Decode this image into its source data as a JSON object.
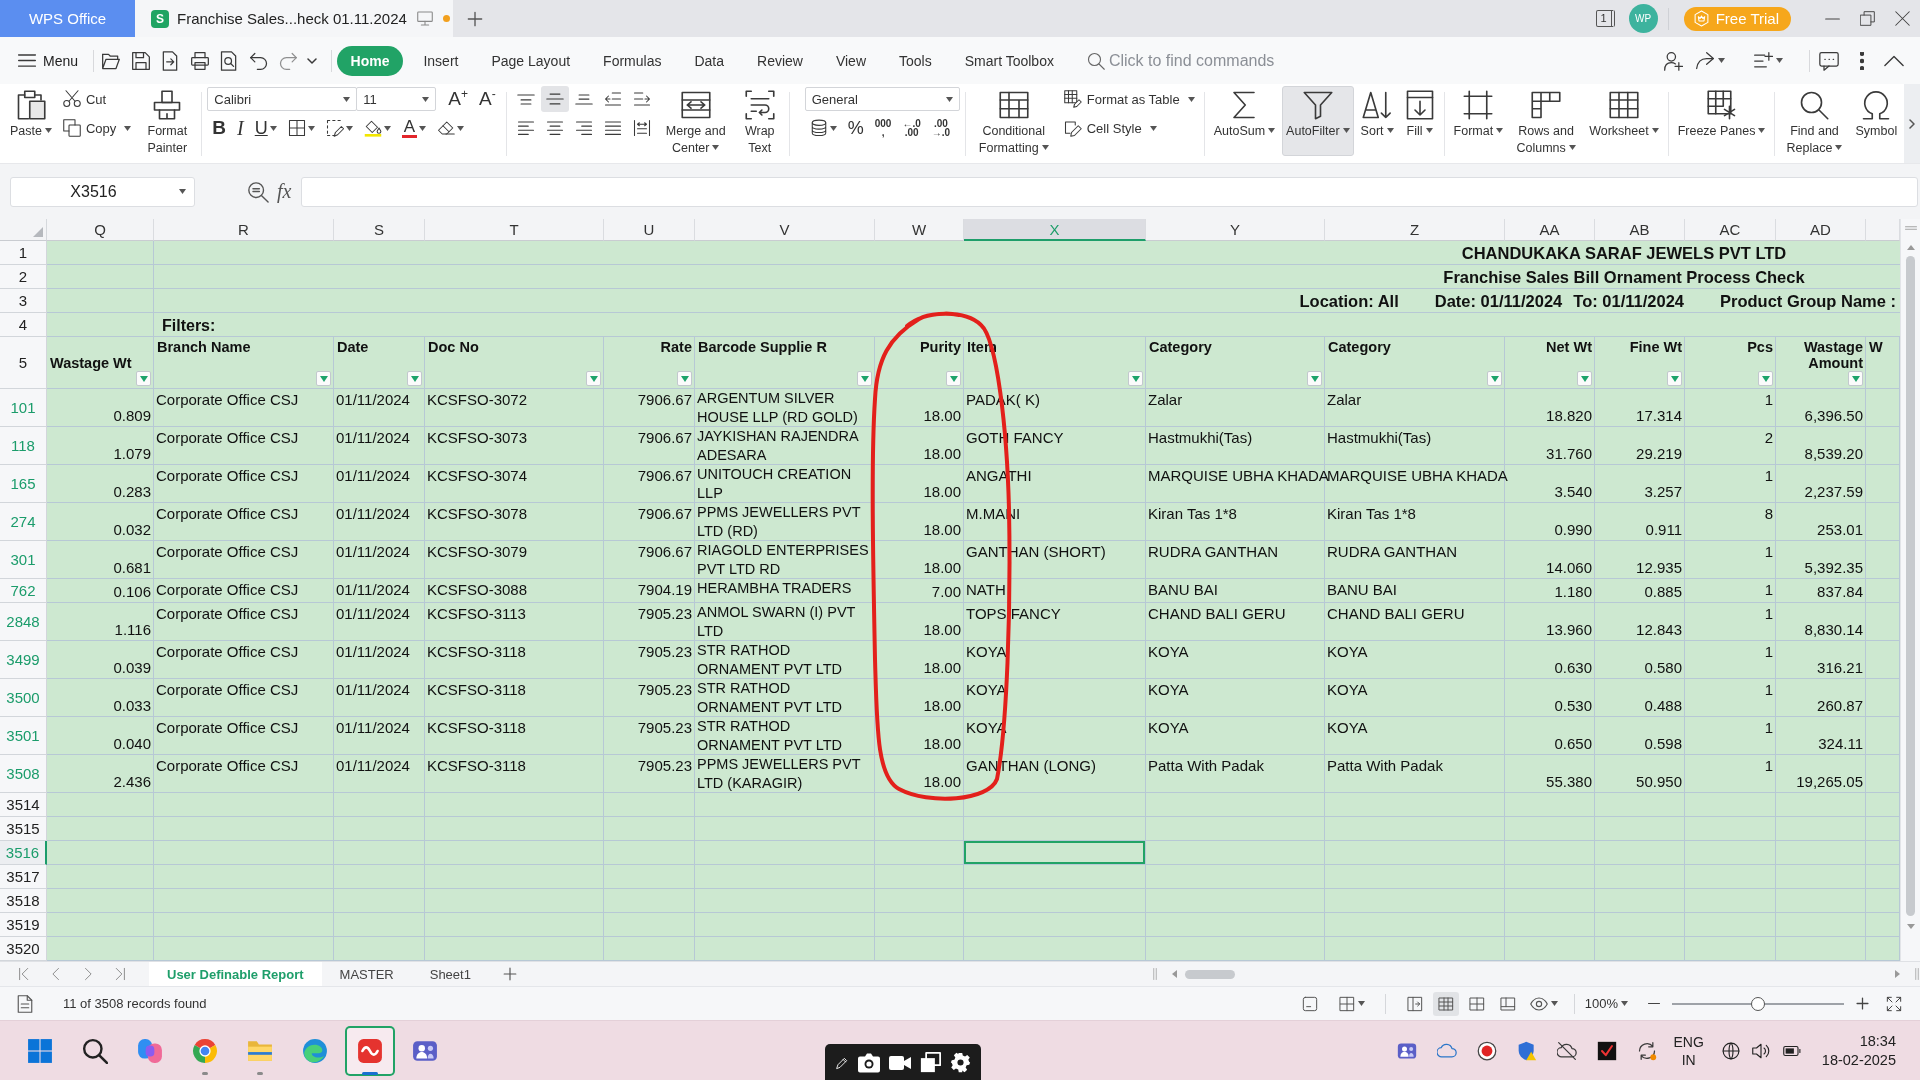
{
  "title_bar": {
    "tabs": [
      {
        "kind": "app",
        "label": "WPS Office",
        "selected": false
      },
      {
        "kind": "document",
        "label": "Franchise Sales...heck 01.11.2024",
        "logo": "S",
        "selected": true,
        "modified": true
      }
    ],
    "window_count": "1",
    "avatar": "WP",
    "trial_button": "Free Trial"
  },
  "menu_bar": {
    "menu_label": "Menu",
    "tabs": [
      {
        "label": "Home",
        "selected": true
      },
      {
        "label": "Insert",
        "selected": false
      },
      {
        "label": "Page Layout",
        "selected": false
      },
      {
        "label": "Formulas",
        "selected": false
      },
      {
        "label": "Data",
        "selected": false
      },
      {
        "label": "Review",
        "selected": false
      },
      {
        "label": "View",
        "selected": false
      },
      {
        "label": "Tools",
        "selected": false
      },
      {
        "label": "Smart Toolbox",
        "selected": false
      }
    ],
    "search": {
      "placeholder": "Click to find commands"
    }
  },
  "ribbon": {
    "groups": [
      {
        "items": [
          {
            "kind": "large",
            "label": "Paste",
            "dropdown": true,
            "selected": false
          },
          {
            "kind": "stack",
            "upper": [
              {
                "kind": "small",
                "label": "Cut",
                "dropdown": false,
                "selected": false
              }
            ],
            "lower": [
              {
                "kind": "small",
                "label": "Copy",
                "dropdown": true,
                "selected": false
              }
            ]
          },
          {
            "kind": "large",
            "label": "Format Painter",
            "dropdown": false,
            "selected": false
          }
        ]
      },
      {
        "items": [
          {
            "kind": "stack",
            "upper": [
              {
                "kind": "field",
                "value": "Calibri"
              },
              {
                "kind": "field",
                "value": "11"
              },
              {
                "kind": "glyph",
                "label": "A$^{+}$",
                "dropdown": false,
                "selected": false
              },
              {
                "kind": "glyph",
                "label": "A$^{-}$",
                "dropdown": false,
                "selected": false
              }
            ],
            "lower": [
              {
                "kind": "glyph",
                "label": "B",
                "dropdown": false,
                "selected": false
              },
              {
                "kind": "glyph",
                "label": "I",
                "dropdown": false,
                "selected": false
              },
              {
                "kind": "glyph",
                "label": "U",
                "dropdown": true,
                "selected": false
              },
              {
                "kind": "tool",
                "dropdown": true,
                "selected": false
              },
              {
                "kind": "tool",
                "dropdown": true,
                "selected": false
              },
              {
                "kind": "tool",
                "dropdown": true,
                "selected": false
              },
              {
                "kind": "glyph",
                "label": "A",
                "dropdown": true,
                "selected": false
              },
              {
                "kind": "tool",
                "dropdown": true,
                "selected": false
              }
            ]
          }
        ]
      },
      {
        "items": [
          {
            "kind": "stack",
            "upper": [
              {
                "kind": "tool",
                "dropdown": false,
                "selected": false
              },
              {
                "kind": "tool",
                "dropdown": false,
                "selected": true
              },
              {
                "kind": "tool",
                "dropdown": false,
                "selected": false
              },
              {
                "kind": "tool",
                "dropdown": false,
                "selected": false
              },
              {
                "kind": "tool",
                "dropdown": false,
                "selected": false
              }
            ],
            "lower": [
              {
                "kind": "tool",
                "dropdown": false,
                "selected": false
              },
              {
                "kind": "tool",
                "dropdown": false,
                "selected": false
              },
              {
                "kind": "tool",
                "dropdown": false,
                "selected": false
              },
              {
                "kind": "tool",
                "dropdown": false,
                "selected": false
              },
              {
                "kind": "tool",
                "dropdown": false,
                "selected": false
              }
            ]
          },
          {
            "kind": "large",
            "label": "Merge and Center",
            "dropdown": true,
            "selected": false
          },
          {
            "kind": "large",
            "label": "Wrap Text",
            "dropdown": false,
            "selected": false
          }
        ]
      },
      {
        "items": [
          {
            "kind": "stack",
            "upper": [
              {
                "kind": "field",
                "value": "General"
              }
            ],
            "lower": [
              {
                "kind": "tool",
                "dropdown": true,
                "selected": false
              },
              {
                "kind": "glyph",
                "label": "%",
                "dropdown": false,
                "selected": false
              },
              {
                "kind": "glyph",
                "lines": [
                  "000",
                  ","
                ],
                "dropdown": false,
                "selected": false
              },
              {
                "kind": "glyph",
                "lines": [
                  "←.0",
                  ".00"
                ],
                "dropdown": false,
                "selected": false
              },
              {
                "kind": "glyph",
                "lines": [
                  ".00",
                  "→.0"
                ],
                "dropdown": false,
                "selected": false
              }
            ]
          }
        ]
      },
      {
        "items": [
          {
            "kind": "large",
            "label": "Conditional Formatting",
            "dropdown": true,
            "selected": false
          },
          {
            "kind": "stack",
            "upper": [
              {
                "kind": "small",
                "label": "Format as Table",
                "dropdown": true,
                "selected": false
              }
            ],
            "lower": [
              {
                "kind": "small",
                "label": "Cell Style",
                "dropdown": true,
                "selected": false
              }
            ]
          }
        ]
      },
      {
        "items": [
          {
            "kind": "large",
            "label": "AutoSum",
            "dropdown": true,
            "selected": false
          },
          {
            "kind": "large",
            "label": "AutoFilter",
            "dropdown": true,
            "selected": true
          },
          {
            "kind": "large",
            "label": "Sort",
            "dropdown": true,
            "selected": false
          },
          {
            "kind": "large",
            "label": "Fill",
            "dropdown": true,
            "selected": false
          }
        ]
      },
      {
        "items": [
          {
            "kind": "large",
            "label": "Format",
            "dropdown": true,
            "selected": false
          },
          {
            "kind": "large",
            "label": "Rows and Columns",
            "dropdown": true,
            "selected": false
          },
          {
            "kind": "large",
            "label": "Worksheet",
            "dropdown": true,
            "selected": false
          }
        ]
      },
      {
        "items": [
          {
            "kind": "large",
            "label": "Freeze Panes",
            "dropdown": true,
            "selected": false
          }
        ]
      },
      {
        "items": [
          {
            "kind": "large",
            "label": "Find and Replace",
            "dropdown": true,
            "selected": false
          },
          {
            "kind": "large",
            "label": "Symbol",
            "dropdown": false,
            "selected": false
          }
        ]
      }
    ]
  },
  "formula_bar": {
    "cell_reference": "X3516",
    "function_label": "fx"
  },
  "sheet": {
    "columns": [
      {
        "label": "Q",
        "selected": false
      },
      {
        "label": "R",
        "selected": false
      },
      {
        "label": "S",
        "selected": false
      },
      {
        "label": "T",
        "selected": false
      },
      {
        "label": "U",
        "selected": false
      },
      {
        "label": "V",
        "selected": false
      },
      {
        "label": "W",
        "selected": false
      },
      {
        "label": "X",
        "selected": true
      },
      {
        "label": "Y",
        "selected": false
      },
      {
        "label": "Z",
        "selected": false
      },
      {
        "label": "AA",
        "selected": false
      },
      {
        "label": "AB",
        "selected": false
      },
      {
        "label": "AC",
        "selected": false
      },
      {
        "label": "AD",
        "selected": false
      }
    ],
    "rows": [
      {
        "number": "1",
        "kind": "title",
        "text": "CHANDUKAKA SARAF JEWELS PVT LTD",
        "filtered": false,
        "selected": false
      },
      {
        "number": "2",
        "kind": "subtitle",
        "text": "Franchise Sales Bill Ornament Process Check",
        "filtered": false,
        "selected": false
      },
      {
        "number": "3",
        "kind": "report_filters",
        "texts": [
          "Location: All",
          "Date: 01/11/2024",
          "To: 01/11/2024",
          "Product Group Name :"
        ],
        "filtered": false,
        "selected": false
      },
      {
        "number": "4",
        "kind": "label",
        "caption": "Filters:",
        "filtered": false,
        "selected": false
      },
      {
        "number": "5",
        "kind": "header",
        "cells": [
          {
            "label": "Wastage Wt",
            "filter": true
          },
          {
            "label": "Branch Name",
            "filter": true
          },
          {
            "label": "Date",
            "filter": true
          },
          {
            "label": "Doc No",
            "filter": true
          },
          {
            "label": "Rate",
            "filter": true
          },
          {
            "label": "Barcode Supplie R",
            "filter": true
          },
          {
            "label": "Purity",
            "filter": true
          },
          {
            "label": "Item",
            "filter": true
          },
          {
            "label": "Category",
            "filter": true
          },
          {
            "label": "Category",
            "filter": true
          },
          {
            "label": "Net Wt",
            "filter": true
          },
          {
            "label": "Fine Wt",
            "filter": true
          },
          {
            "label": "Pcs",
            "filter": true
          },
          {
            "label": "Wastage Amount",
            "filter": true
          },
          {
            "label": "W",
            "filter": false
          }
        ],
        "filtered": false,
        "selected": false
      },
      {
        "number": "101",
        "kind": "data",
        "cells": [
          "0.809",
          "Corporate Office CSJ",
          "01/11/2024",
          "KCSFSO-3072",
          "7906.67",
          "ARGENTUM SILVER HOUSE LLP (RD GOLD)",
          "18.00",
          "PADAK( K)",
          "Zalar",
          "Zalar",
          "18.820",
          "17.314",
          "1",
          "6,396.50"
        ],
        "filtered": true,
        "selected": false
      },
      {
        "number": "118",
        "kind": "data",
        "cells": [
          "1.079",
          "Corporate Office CSJ",
          "01/11/2024",
          "KCSFSO-3073",
          "7906.67",
          "JAYKISHAN RAJENDRA ADESARA",
          "18.00",
          "GOTH FANCY",
          "Hastmukhi(Tas)",
          "Hastmukhi(Tas)",
          "31.760",
          "29.219",
          "2",
          "8,539.20"
        ],
        "filtered": true,
        "selected": false
      },
      {
        "number": "165",
        "kind": "data",
        "cells": [
          "0.283",
          "Corporate Office CSJ",
          "01/11/2024",
          "KCSFSO-3074",
          "7906.67",
          "UNITOUCH CREATION LLP",
          "18.00",
          "ANGATHI",
          "MARQUISE UBHA KHADA",
          "MARQUISE UBHA KHADA",
          "3.540",
          "3.257",
          "1",
          "2,237.59"
        ],
        "filtered": true,
        "selected": false
      },
      {
        "number": "274",
        "kind": "data",
        "cells": [
          "0.032",
          "Corporate Office CSJ",
          "01/11/2024",
          "KCSFSO-3078",
          "7906.67",
          "PPMS JEWELLERS PVT LTD (RD)",
          "18.00",
          "M.MANI",
          "Kiran Tas 1*8",
          "Kiran Tas 1*8",
          "0.990",
          "0.911",
          "8",
          "253.01"
        ],
        "filtered": true,
        "selected": false
      },
      {
        "number": "301",
        "kind": "data",
        "cells": [
          "0.681",
          "Corporate Office CSJ",
          "01/11/2024",
          "KCSFSO-3079",
          "7906.67",
          "RIAGOLD ENTERPRISES PVT LTD RD",
          "18.00",
          "GANTHAN (SHORT)",
          "RUDRA GANTHAN",
          "RUDRA GANTHAN",
          "14.060",
          "12.935",
          "1",
          "5,392.35"
        ],
        "filtered": true,
        "selected": false
      },
      {
        "number": "762",
        "kind": "data",
        "cells": [
          "0.106",
          "Corporate Office CSJ",
          "01/11/2024",
          "KCSFSO-3088",
          "7904.19",
          "HERAMBHA TRADERS",
          "7.00",
          "NATH",
          "BANU BAI",
          "BANU BAI",
          "1.180",
          "0.885",
          "1",
          "837.84"
        ],
        "filtered": true,
        "selected": false
      },
      {
        "number": "2848",
        "kind": "data",
        "cells": [
          "1.116",
          "Corporate Office CSJ",
          "01/11/2024",
          "KCSFSO-3113",
          "7905.23",
          "ANMOL SWARN (I) PVT LTD",
          "18.00",
          "TOPS FANCY",
          "CHAND BALI GERU",
          "CHAND BALI GERU",
          "13.960",
          "12.843",
          "1",
          "8,830.14"
        ],
        "filtered": true,
        "selected": false
      },
      {
        "number": "3499",
        "kind": "data",
        "cells": [
          "0.039",
          "Corporate Office CSJ",
          "01/11/2024",
          "KCSFSO-3118",
          "7905.23",
          "STR RATHOD ORNAMENT PVT LTD",
          "18.00",
          "KOYA",
          "KOYA",
          "KOYA",
          "0.630",
          "0.580",
          "1",
          "316.21"
        ],
        "filtered": true,
        "selected": false
      },
      {
        "number": "3500",
        "kind": "data",
        "cells": [
          "0.033",
          "Corporate Office CSJ",
          "01/11/2024",
          "KCSFSO-3118",
          "7905.23",
          "STR RATHOD ORNAMENT PVT LTD",
          "18.00",
          "KOYA",
          "KOYA",
          "KOYA",
          "0.530",
          "0.488",
          "1",
          "260.87"
        ],
        "filtered": true,
        "selected": false
      },
      {
        "number": "3501",
        "kind": "data",
        "cells": [
          "0.040",
          "Corporate Office CSJ",
          "01/11/2024",
          "KCSFSO-3118",
          "7905.23",
          "STR RATHOD ORNAMENT PVT LTD",
          "18.00",
          "KOYA",
          "KOYA",
          "KOYA",
          "0.650",
          "0.598",
          "1",
          "324.11"
        ],
        "filtered": true,
        "selected": false
      },
      {
        "number": "3508",
        "kind": "data",
        "cells": [
          "2.436",
          "Corporate Office CSJ",
          "01/11/2024",
          "KCSFSO-3118",
          "7905.23",
          "PPMS JEWELLERS PVT LTD (KARAGIR)",
          "18.00",
          "GANTHAN (LONG)",
          "Patta With Padak",
          "Patta With Padak",
          "55.380",
          "50.950",
          "1",
          "19,265.05"
        ],
        "filtered": true,
        "selected": false
      },
      {
        "number": "3514",
        "kind": "empty",
        "filtered": false,
        "selected": false
      },
      {
        "number": "3515",
        "kind": "empty",
        "filtered": false,
        "selected": false
      },
      {
        "number": "3516",
        "kind": "empty",
        "filtered": false,
        "selected": true
      },
      {
        "number": "3517",
        "kind": "empty",
        "filtered": false,
        "selected": false
      },
      {
        "number": "3518",
        "kind": "empty",
        "filtered": false,
        "selected": false
      },
      {
        "number": "3519",
        "kind": "empty",
        "filtered": false,
        "selected": false
      },
      {
        "number": "3520",
        "kind": "empty",
        "filtered": false,
        "selected": false
      }
    ]
  },
  "sheet_tabs": [
    {
      "label": "User Definable Report",
      "selected": true
    },
    {
      "label": "MASTER",
      "selected": false
    },
    {
      "label": "Sheet1",
      "selected": false
    }
  ],
  "status_bar": {
    "records": "11 of 3508 records found",
    "view_modes": [
      {
        "selected": false
      },
      {
        "selected": true
      },
      {
        "selected": false
      },
      {
        "selected": false
      }
    ],
    "zoom": "100%",
    "zoom_slider": {
      "level": 0.5
    }
  },
  "taskbar": {
    "apps": [
      {
        "running": false,
        "active": false
      },
      {
        "running": false,
        "active": false
      },
      {
        "running": false,
        "active": false
      },
      {
        "running": true,
        "active": false
      },
      {
        "running": true,
        "active": false
      },
      {
        "running": false,
        "active": false
      },
      {
        "running": true,
        "active": true
      },
      {
        "running": false,
        "active": false
      }
    ],
    "language": "ENG",
    "region": "IN",
    "time": "18:34",
    "date": "18-02-2025"
  }
}
